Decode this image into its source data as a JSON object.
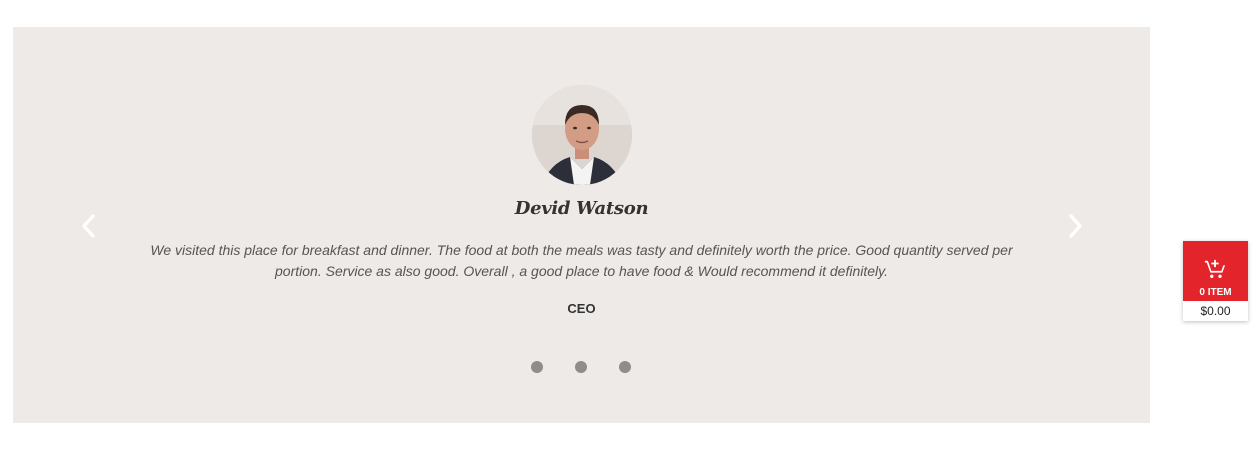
{
  "testimonial": {
    "name": "Devid Watson",
    "quote": "We visited this place for breakfast and dinner. The food at both the meals was tasty and definitely worth the price. Good quantity served per portion. Service as also good. Overall , a good place to have food & Would recommend it definitely.",
    "role": "CEO",
    "avatar_icon": "person-photo"
  },
  "slider": {
    "background_color": "#eeeae7",
    "prev_icon": "chevron-left-icon",
    "next_icon": "chevron-right-icon",
    "dot_count": 3,
    "dot_color": "#8f8c8a"
  },
  "cart": {
    "icon": "add-to-cart-icon",
    "count_label": "0 ITEM",
    "total": "$0.00",
    "accent_color": "#e3242b"
  }
}
